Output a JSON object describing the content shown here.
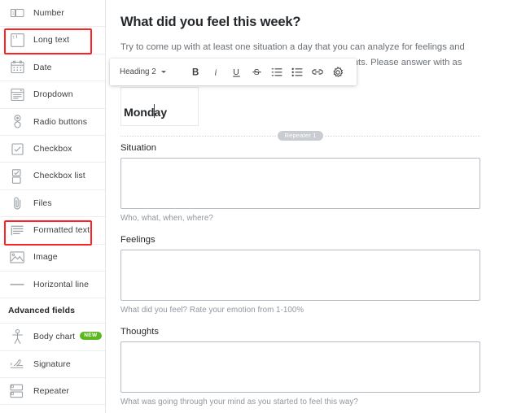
{
  "sidebar": {
    "basic_fields": [
      {
        "label": "Number",
        "icon": "number-field-icon"
      },
      {
        "label": "Long text",
        "icon": "long-text-field-icon"
      },
      {
        "label": "Date",
        "icon": "date-field-icon"
      },
      {
        "label": "Dropdown",
        "icon": "dropdown-field-icon"
      },
      {
        "label": "Radio buttons",
        "icon": "radio-buttons-field-icon"
      },
      {
        "label": "Checkbox",
        "icon": "checkbox-field-icon"
      },
      {
        "label": "Checkbox list",
        "icon": "checkbox-list-field-icon"
      },
      {
        "label": "Files",
        "icon": "paperclip-icon"
      },
      {
        "label": "Formatted text",
        "icon": "formatted-text-field-icon"
      },
      {
        "label": "Image",
        "icon": "image-field-icon"
      },
      {
        "label": "Horizontal line",
        "icon": "horizontal-line-field-icon"
      }
    ],
    "advanced_header": "Advanced fields",
    "advanced_fields": [
      {
        "label": "Body chart",
        "icon": "body-chart-field-icon",
        "badge": "NEW"
      },
      {
        "label": "Signature",
        "icon": "signature-field-icon",
        "badge": ""
      },
      {
        "label": "Repeater",
        "icon": "repeater-field-icon",
        "badge": ""
      }
    ],
    "highlight_color": "#ff2222",
    "highlighted": [
      "Long text",
      "Formatted text"
    ],
    "new_badge_color": "#5cb81f"
  },
  "main": {
    "title": "What did you feel this week?",
    "description": "Try to come up with at least one situation a day that you can analyze for feelings and thoughts. Once you have done so, write down your thoughts. Please answer with as",
    "heading_field": {
      "value": "Monday"
    },
    "repeater_label": "Repeater 1",
    "questions": [
      {
        "label": "Situation",
        "value": "",
        "placeholder": "",
        "help": "Who, what, when, where?"
      },
      {
        "label": "Feelings",
        "value": "",
        "placeholder": "",
        "help": "What did you feel? Rate your emotion from 1-100%"
      },
      {
        "label": "Thoughts",
        "value": "",
        "placeholder": "",
        "help": "What was going through your mind as you started to feel this way?"
      }
    ]
  },
  "toolbar": {
    "style_label": "Heading 2",
    "buttons": [
      {
        "name": "bold",
        "glyph": "B"
      },
      {
        "name": "italic",
        "glyph": "i"
      },
      {
        "name": "underline",
        "glyph": "U"
      },
      {
        "name": "strikethrough",
        "glyph": "S"
      },
      {
        "name": "numbered-list",
        "glyph": ""
      },
      {
        "name": "bulleted-list",
        "glyph": ""
      },
      {
        "name": "link",
        "glyph": ""
      },
      {
        "name": "settings",
        "glyph": ""
      }
    ]
  }
}
